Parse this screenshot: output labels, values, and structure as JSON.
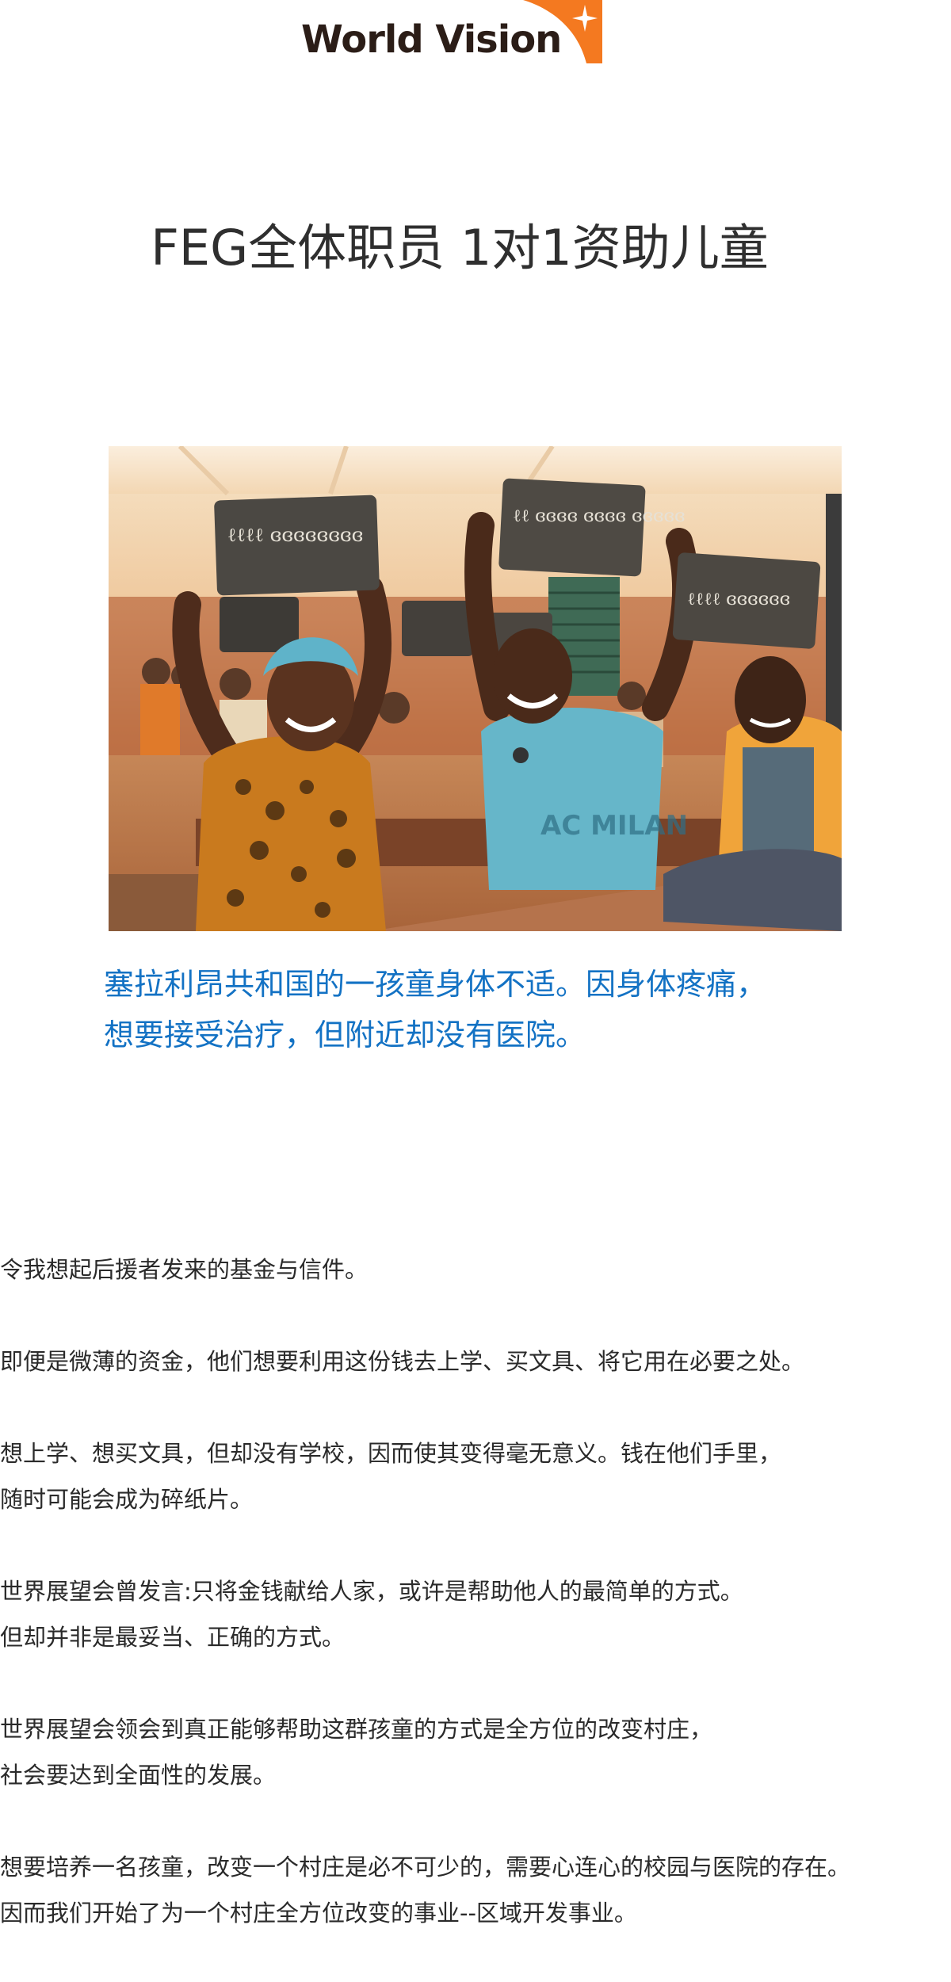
{
  "logo": {
    "text": "World Vision",
    "colors": {
      "text": "#2b1d17",
      "accent": "#f47920"
    }
  },
  "title": "FEG全体职员 1对1资助儿童",
  "photo": {
    "slates": [
      "ℓℓℓℓ ɞɞɞɞɞɞɞɞ",
      "ℓℓ ɞɞɞɞ ɞɞɞɞ ɞɞɞɞɞ",
      "ℓℓℓℓ ɞɞɞɞɞɞ"
    ],
    "shirt_text": "AC MILAN"
  },
  "caption": {
    "line1": "塞拉利昂共和国的一孩童身体不适。因身体疼痛，",
    "line2": "想要接受治疗，但附近却没有医院。"
  },
  "paragraphs": [
    {
      "lines": [
        "令我想起后援者发来的基金与信件。"
      ]
    },
    {
      "lines": [
        "即便是微薄的资金，他们想要利用这份钱去上学、买文具、将它用在必要之处。"
      ]
    },
    {
      "lines": [
        "想上学、想买文具，但却没有学校，因而使其变得毫无意义。钱在他们手里，",
        "随时可能会成为碎纸片。"
      ]
    },
    {
      "lines": [
        "世界展望会曾发言:只将金钱献给人家，或许是帮助他人的最简单的方式。",
        "但却并非是最妥当、正确的方式。"
      ]
    },
    {
      "lines": [
        "世界展望会领会到真正能够帮助这群孩童的方式是全方位的改变村庄，",
        "社会要达到全面性的发展。"
      ]
    },
    {
      "lines": [
        "想要培养一名孩童，改变一个村庄是必不可少的，需要心连心的校园与医院的存在。",
        "因而我们开始了为一个村庄全方位改变的事业--区域开发事业。"
      ]
    }
  ],
  "colors": {
    "caption": "#1372c4",
    "body_text": "#2a2a2a",
    "title": "#2f2f2f"
  }
}
